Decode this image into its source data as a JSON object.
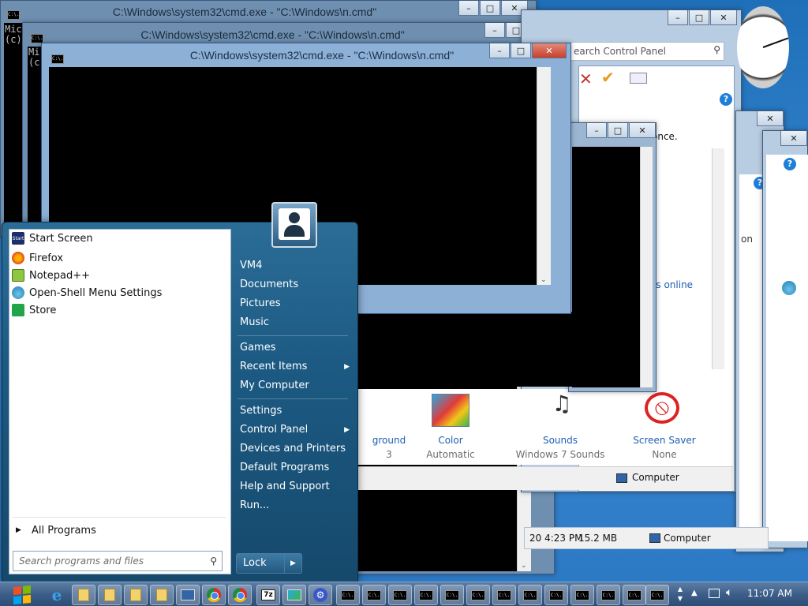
{
  "windows": {
    "cmd_back_title": "C:\\Windows\\system32\\cmd.exe - \"C:\\Windows\\n.cmd\"",
    "cmd_mid_title": "C:\\Windows\\system32\\cmd.exe - \"C:\\Windows\\n.cmd\"",
    "cmd_front_title": "C:\\Windows\\system32\\cmd.exe - \"C:\\Windows\\n.cmd\"",
    "console_text_1": "Mic",
    "console_text_2": "(c)",
    "console_text_3": "Mi",
    "console_text_4": "(c"
  },
  "control_panel": {
    "search_placeholder": "earch Control Panel",
    "text_once": "once.",
    "text_on": "on",
    "link_online": "es online",
    "status_computer": "Computer",
    "status_computer2": "Computer",
    "status_date": "20 4:23 PM",
    "status_size": "15.2 MB",
    "items": [
      {
        "label": "ground",
        "sub": "3"
      },
      {
        "label": "Color",
        "sub": "Automatic"
      },
      {
        "label": "Sounds",
        "sub": "Windows 7 Sounds"
      },
      {
        "label": "Screen Saver",
        "sub": "None"
      }
    ]
  },
  "start_menu": {
    "pinned": [
      {
        "label": "Start Screen",
        "icon": "start-screen-icon"
      },
      {
        "label": "Firefox",
        "icon": "firefox-icon"
      },
      {
        "label": "Notepad++",
        "icon": "notepad-plus-plus-icon"
      },
      {
        "label": "Open-Shell Menu Settings",
        "icon": "open-shell-icon"
      },
      {
        "label": "Store",
        "icon": "store-icon"
      }
    ],
    "all_programs": "All Programs",
    "search_placeholder": "Search programs and files",
    "right": {
      "user": "VM4",
      "documents": "Documents",
      "pictures": "Pictures",
      "music": "Music",
      "games": "Games",
      "recent_items": "Recent Items",
      "my_computer": "My Computer",
      "settings": "Settings",
      "control_panel": "Control Panel",
      "devices_printers": "Devices and Printers",
      "default_programs": "Default Programs",
      "help_support": "Help and Support",
      "run": "Run..."
    },
    "lock": "Lock"
  },
  "taskbar": {
    "time": "11:07 AM",
    "cmd_icon_text": "C:\\."
  },
  "colors": {
    "accent": "#2b6d97",
    "desktop": "#2b77c2",
    "close_button": "#c8402b"
  }
}
